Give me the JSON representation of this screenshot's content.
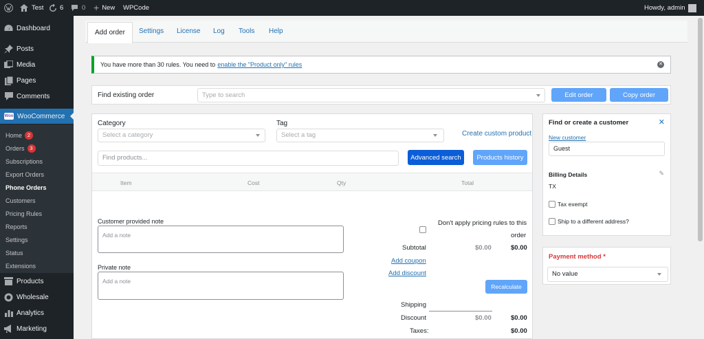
{
  "adminbar": {
    "site_name": "Test",
    "updates_count": "6",
    "comments_count": "0",
    "new_label": "New",
    "wpcode_label": "WPCode",
    "greeting": "Howdy, admin"
  },
  "sidebar": {
    "dashboard": "Dashboard",
    "posts": "Posts",
    "media": "Media",
    "pages": "Pages",
    "comments": "Comments",
    "woocommerce": "WooCommerce",
    "woo_badge": "Woo",
    "submenu": {
      "home": "Home",
      "home_count": "2",
      "orders": "Orders",
      "orders_count": "3",
      "subscriptions": "Subscriptions",
      "export_orders": "Export Orders",
      "phone_orders": "Phone Orders",
      "customers": "Customers",
      "pricing_rules": "Pricing Rules",
      "reports": "Reports",
      "settings": "Settings",
      "status": "Status",
      "extensions": "Extensions"
    },
    "products": "Products",
    "wholesale": "Wholesale",
    "analytics": "Analytics",
    "marketing": "Marketing"
  },
  "tabs": [
    "Add order",
    "Settings",
    "License",
    "Log",
    "Tools",
    "Help"
  ],
  "notice": {
    "text": "You have more than 30 rules. You need to ",
    "link": "enable the \"Product only\" rules"
  },
  "find_order": {
    "label": "Find existing order",
    "placeholder": "Type to search",
    "edit_button": "Edit order",
    "copy_button": "Copy order"
  },
  "products": {
    "category_label": "Category",
    "category_placeholder": "Select a category",
    "tag_label": "Tag",
    "tag_placeholder": "Select a tag",
    "create_custom_link": "Create custom product",
    "search_placeholder": "Find products...",
    "advanced_search_button": "Advanced search",
    "history_button": "Products history",
    "columns": [
      "Item",
      "Cost",
      "Qty",
      "Total"
    ]
  },
  "notes": {
    "customer_label": "Customer provided note",
    "customer_placeholder": "Add a note",
    "private_label": "Private note",
    "private_placeholder": "Add a note"
  },
  "totals": {
    "pricing_rules_label_line1": "Don't apply pricing rules to this",
    "pricing_rules_label_line2": "order",
    "subtotal_label": "Subtotal",
    "subtotal_cost": "$0.00",
    "subtotal_total": "$0.00",
    "add_coupon": "Add coupon",
    "add_discount": "Add discount",
    "recalculate_button": "Recalculate",
    "shipping_label": "Shipping",
    "discount_label": "Discount",
    "discount_cost": "$0.00",
    "discount_total": "$0.00",
    "taxes_label": "Taxes:",
    "taxes_total": "$0.00"
  },
  "customer_card": {
    "title": "Find or create a customer",
    "new_customer_link": "New customer",
    "customer_value": "Guest",
    "billing_title": "Billing Details",
    "billing_state": "TX",
    "tax_exempt_label": "Tax exempt",
    "ship_different_label": "Ship to a different address?"
  },
  "payment_card": {
    "title": "Payment method",
    "required_marker": "*",
    "selected_value": "No value"
  },
  "colors": {
    "accent": "#2271b1",
    "sidebar_bg": "#1d2327",
    "button_light": "#60a5fa",
    "button_dark": "#0b5ed7",
    "notice_success": "#00a32a",
    "required_red": "#d63638"
  }
}
